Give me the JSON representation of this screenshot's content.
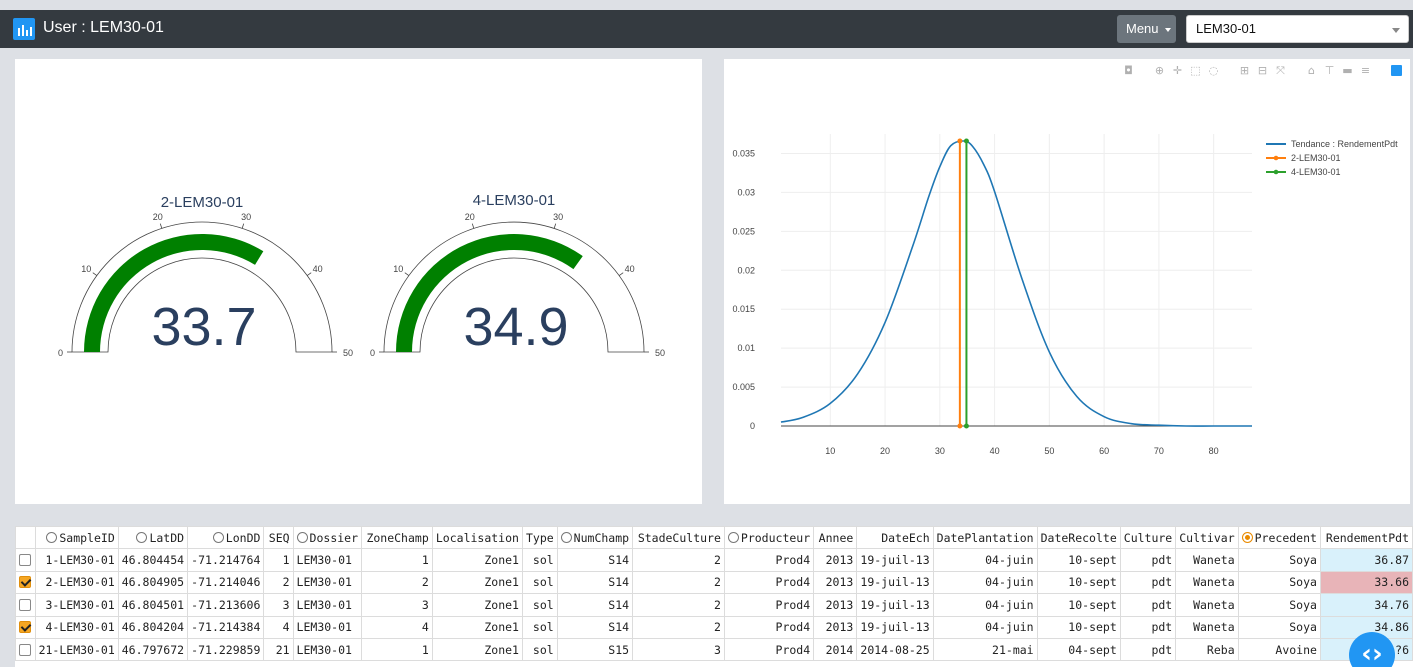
{
  "header": {
    "title": "User : LEM30-01",
    "menu_label": "Menu",
    "selected_user": "LEM30-01",
    "logo_icon": "bar-chart-icon"
  },
  "gauges": [
    {
      "title": "2-LEM30-01",
      "value": 33.7,
      "display": "33.7",
      "min": 0,
      "max": 50,
      "ticks": [
        0,
        10,
        20,
        30,
        40,
        50
      ],
      "bar_color": "#008000"
    },
    {
      "title": "4-LEM30-01",
      "value": 34.9,
      "display": "34.9",
      "min": 0,
      "max": 50,
      "ticks": [
        0,
        10,
        20,
        30,
        40,
        50
      ],
      "bar_color": "#008000"
    }
  ],
  "chart_data": {
    "type": "line",
    "title": "",
    "xlabel": "",
    "ylabel": "",
    "xlim": [
      1,
      87
    ],
    "ylim": [
      0,
      0.0375
    ],
    "xticks": [
      10,
      20,
      30,
      40,
      50,
      60,
      70,
      80
    ],
    "yticks": [
      0,
      0.005,
      0.01,
      0.015,
      0.02,
      0.025,
      0.03,
      0.035
    ],
    "ytick_labels": [
      "0",
      "0.005",
      "0.01",
      "0.015",
      "0.02",
      "0.025",
      "0.03",
      "0.035"
    ],
    "grid": true,
    "legend": "top-right",
    "series": [
      {
        "name": "Tendance : RendementPdt",
        "color": "#1f77b4",
        "x": [
          1,
          5,
          10,
          15,
          20,
          25,
          28,
          30,
          32,
          34.4,
          36,
          38,
          40,
          45,
          50,
          55,
          60,
          65,
          70,
          75,
          80,
          87
        ],
        "y": [
          0.0005,
          0.0011,
          0.0029,
          0.0067,
          0.0133,
          0.023,
          0.0295,
          0.0333,
          0.036,
          0.0366,
          0.0359,
          0.0336,
          0.0301,
          0.0189,
          0.0095,
          0.0038,
          0.0012,
          0.0003,
          0.0001,
          0.0,
          0.0,
          0.0
        ]
      },
      {
        "name": "2-LEM30-01",
        "color": "#ff7f0e",
        "x": [
          33.66,
          33.66
        ],
        "y": [
          0,
          0.0366
        ]
      },
      {
        "name": "4-LEM30-01",
        "color": "#2ca02c",
        "x": [
          34.86,
          34.86
        ],
        "y": [
          0,
          0.0366
        ]
      }
    ]
  },
  "modebar_icons": [
    "camera-icon",
    "zoom-icon",
    "pan-icon",
    "box-select-icon",
    "lasso-icon",
    "zoom-in-icon",
    "zoom-out-icon",
    "autoscale-icon",
    "reset-axes-icon",
    "spike-lines-icon",
    "hover-closest-icon",
    "hover-compare-icon",
    "plotly-logo-icon"
  ],
  "table": {
    "columns": [
      {
        "label": "",
        "radio": false
      },
      {
        "label": "SampleID",
        "radio": true,
        "selected": false
      },
      {
        "label": "LatDD",
        "radio": true,
        "selected": false
      },
      {
        "label": "LonDD",
        "radio": true,
        "selected": false
      },
      {
        "label": "SEQ",
        "radio": false
      },
      {
        "label": "Dossier",
        "radio": true,
        "selected": false
      },
      {
        "label": "ZoneChamp",
        "radio": false
      },
      {
        "label": "Localisation",
        "radio": false
      },
      {
        "label": "Type",
        "radio": false
      },
      {
        "label": "NumChamp",
        "radio": true,
        "selected": false
      },
      {
        "label": "StadeCulture",
        "radio": false
      },
      {
        "label": "Producteur",
        "radio": true,
        "selected": false
      },
      {
        "label": "Annee",
        "radio": false
      },
      {
        "label": "DateEch",
        "radio": false
      },
      {
        "label": "DatePlantation",
        "radio": false
      },
      {
        "label": "DateRecolte",
        "radio": false
      },
      {
        "label": "Culture",
        "radio": false
      },
      {
        "label": "Cultivar",
        "radio": false
      },
      {
        "label": "Precedent",
        "radio": true,
        "selected": true
      },
      {
        "label": "RendementPdt",
        "radio": false
      }
    ],
    "rows": [
      {
        "checked": false,
        "cells": [
          "1-LEM30-01",
          "46.804454",
          "-71.214764",
          "1",
          "LEM30-01",
          "1",
          "Zone1",
          "sol",
          "S14",
          "2",
          "Prod4",
          "2013",
          "19-juil-13",
          "04-juin",
          "10-sept",
          "pdt",
          "Waneta",
          "Soya",
          "36.87"
        ]
      },
      {
        "checked": true,
        "cells": [
          "2-LEM30-01",
          "46.804905",
          "-71.214046",
          "2",
          "LEM30-01",
          "2",
          "Zone1",
          "sol",
          "S14",
          "2",
          "Prod4",
          "2013",
          "19-juil-13",
          "04-juin",
          "10-sept",
          "pdt",
          "Waneta",
          "Soya",
          "33.66"
        ]
      },
      {
        "checked": false,
        "cells": [
          "3-LEM30-01",
          "46.804501",
          "-71.213606",
          "3",
          "LEM30-01",
          "3",
          "Zone1",
          "sol",
          "S14",
          "2",
          "Prod4",
          "2013",
          "19-juil-13",
          "04-juin",
          "10-sept",
          "pdt",
          "Waneta",
          "Soya",
          "34.76"
        ]
      },
      {
        "checked": true,
        "cells": [
          "4-LEM30-01",
          "46.804204",
          "-71.214384",
          "4",
          "LEM30-01",
          "4",
          "Zone1",
          "sol",
          "S14",
          "2",
          "Prod4",
          "2013",
          "19-juil-13",
          "04-juin",
          "10-sept",
          "pdt",
          "Waneta",
          "Soya",
          "34.86"
        ]
      },
      {
        "checked": false,
        "cells": [
          "21-LEM30-01",
          "46.797672",
          "-71.229859",
          "21",
          "LEM30-01",
          "1",
          "Zone1",
          "sol",
          "S15",
          "3",
          "Prod4",
          "2014",
          "2014-08-25",
          "21-mai",
          "04-sept",
          "pdt",
          "Reba",
          "Avoine",
          "?6"
        ]
      }
    ],
    "selected_row_index": 1
  },
  "colors": {
    "accent": "#2196f3",
    "topbar": "#343a40",
    "highlight": "#d9f1fb",
    "highlight_selected": "#e8b4b8"
  }
}
